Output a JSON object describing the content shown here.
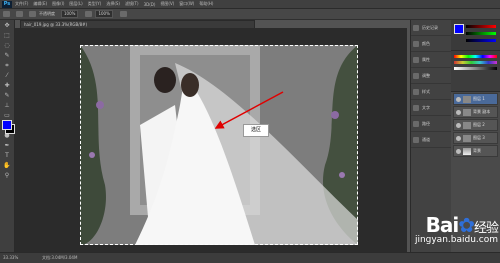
{
  "app": {
    "logo": "Ps"
  },
  "menu": [
    "文件(F)",
    "编辑(E)",
    "图像(I)",
    "图层(L)",
    "类型(Y)",
    "选择(S)",
    "滤镜(T)",
    "3D(D)",
    "视图(V)",
    "窗口(W)",
    "帮助(H)"
  ],
  "options": {
    "feather": "100%",
    "mode": "不透明度",
    "flow": "100%"
  },
  "document": {
    "tab_title": "hair_019.jpg @ 33.3%(RGB/8#)"
  },
  "annotation": {
    "label": "选区"
  },
  "status": {
    "zoom": "33.33%",
    "doc_size": "文档:3.04M/3.04M"
  },
  "panel_icons": [
    "历史记录",
    "颜色",
    "属性",
    "调整",
    "样式",
    "文字",
    "路径",
    "通道"
  ],
  "layers": [
    {
      "name": "图层 1",
      "selected": true
    },
    {
      "name": "背景 副本",
      "selected": false
    },
    {
      "name": "图层 2",
      "selected": false
    },
    {
      "name": "图层 3",
      "selected": false
    },
    {
      "name": "背景",
      "selected": false
    }
  ],
  "watermark": {
    "brand": "Bai",
    "brand2": "经验",
    "url": "jingyan.baidu.com"
  },
  "colors": {
    "foreground": "#0000ff",
    "background": "#000000",
    "accent": "#4a6a9a"
  }
}
